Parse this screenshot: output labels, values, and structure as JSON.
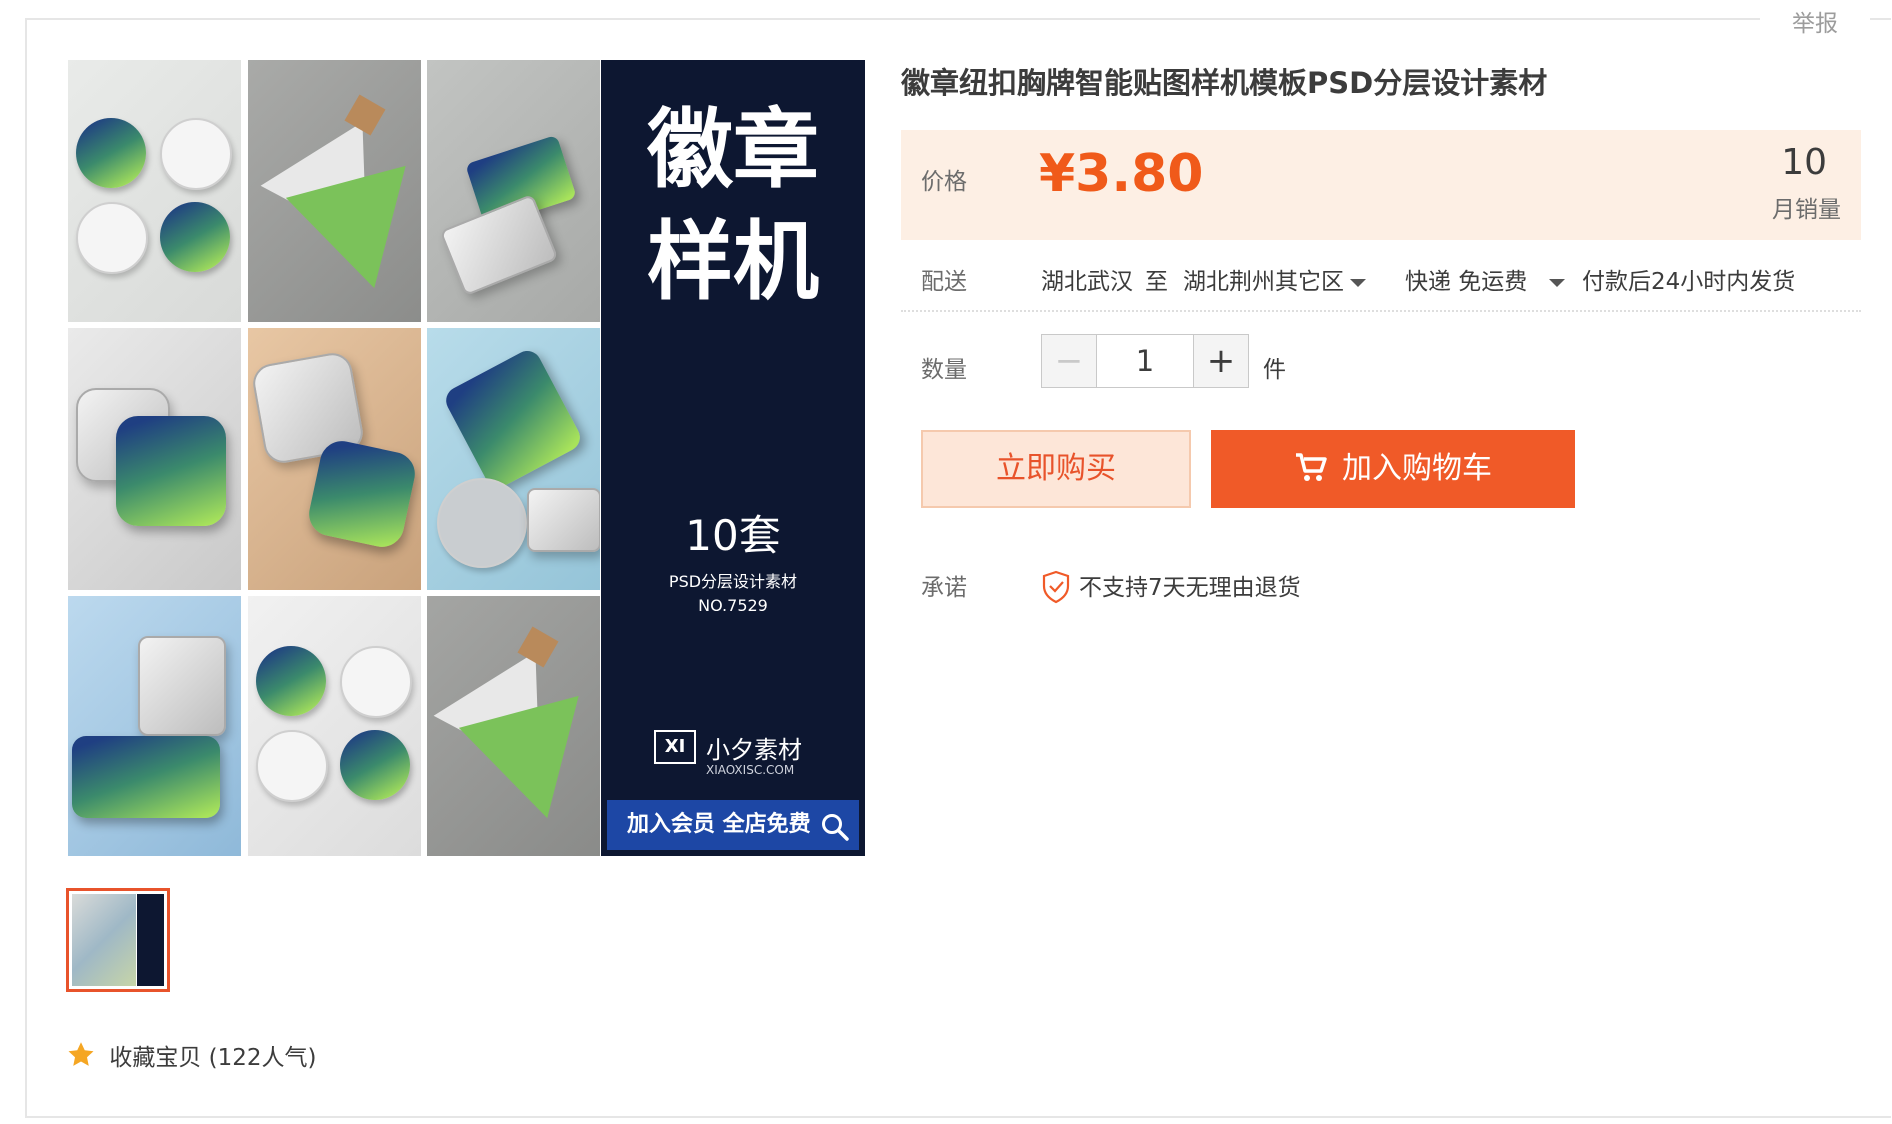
{
  "header": {
    "report_label": "举报"
  },
  "gallery": {
    "poster": {
      "title_line1": "徽章",
      "title_line2": "样机",
      "count": "10套",
      "subtitle": "PSD分层设计素材",
      "code": "NO.7529",
      "logo_text": "XI",
      "brand_name": "小夕素材",
      "brand_url": "XIAOXISC.COM",
      "cta": "加入会员 全店免费"
    },
    "favorite": {
      "label": "收藏宝贝",
      "popularity": "(122人气)"
    }
  },
  "product": {
    "title": "徽章纽扣胸牌智能贴图样机模板PSD分层设计素材",
    "price_label": "价格",
    "price": "¥3.80",
    "monthly_sales_value": "10",
    "monthly_sales_label": "月销量",
    "shipping": {
      "label": "配送",
      "from": "湖北武汉",
      "to_word": "至",
      "destination": "湖北荆州其它区",
      "method": "快递 免运费",
      "dispatch": "付款后24小时内发货"
    },
    "quantity": {
      "label": "数量",
      "value": "1",
      "unit": "件",
      "minus": "−",
      "plus": "+"
    },
    "buy_now_label": "立即购买",
    "add_to_cart_label": "加入购物车",
    "promise": {
      "label": "承诺",
      "text": "不支持7天无理由退货"
    }
  },
  "colors": {
    "accent": "#f05a28",
    "price": "#f05a1a",
    "price_bg": "#fdefe4",
    "poster_bg": "#0d1731"
  }
}
